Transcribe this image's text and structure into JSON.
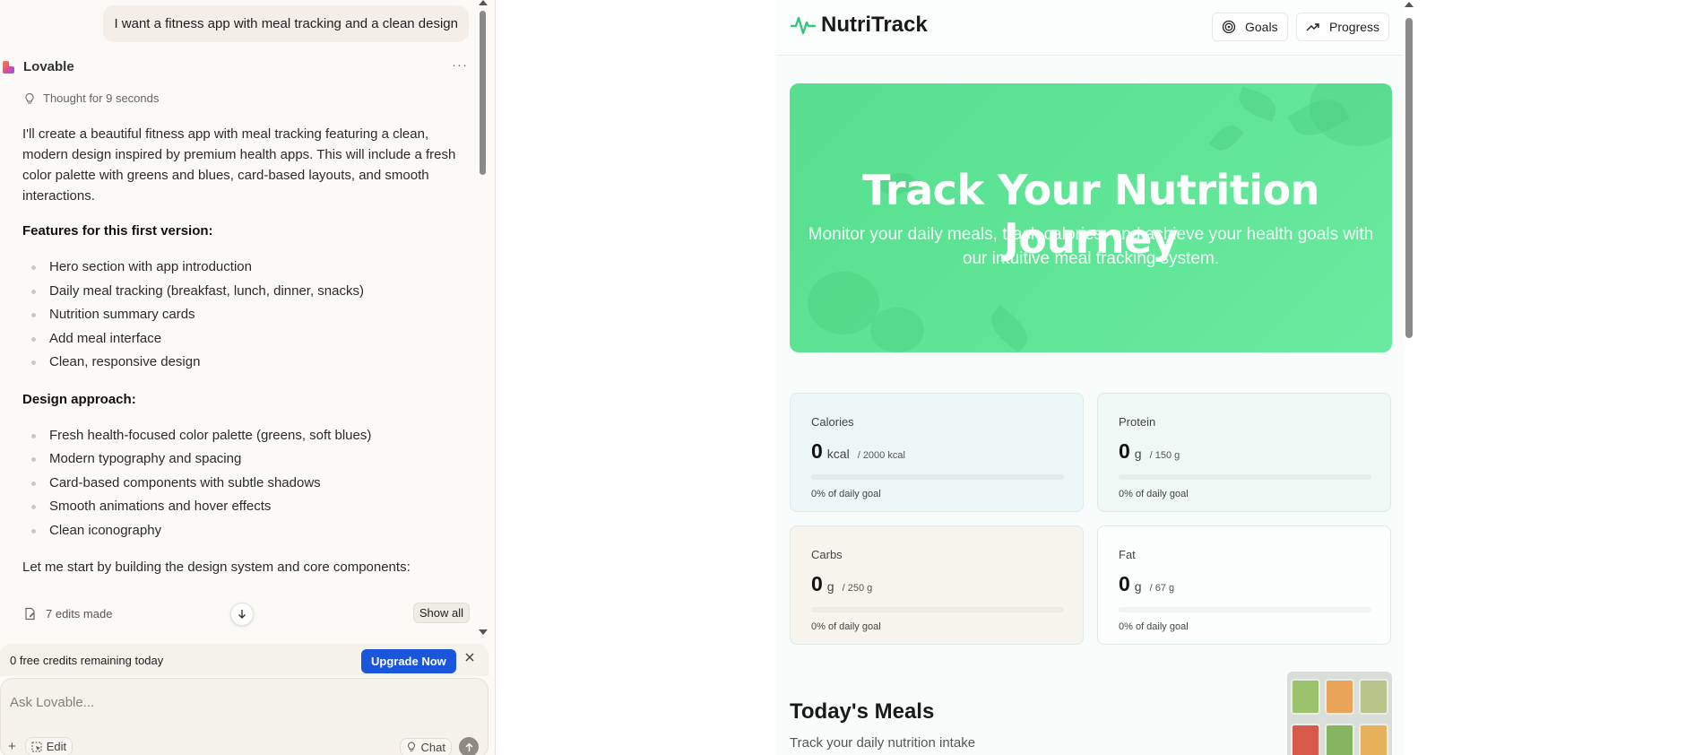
{
  "chat": {
    "user_message": "I want a fitness app with meal tracking and a clean design",
    "assistant_name": "Lovable",
    "more_label": "···",
    "thought": "Thought for 9 seconds",
    "intro": "I'll create a beautiful fitness app with meal tracking featuring a clean, modern design inspired by premium health apps. This will include a fresh color palette with greens and blues, card-based layouts, and smooth interactions.",
    "features_heading": "Features for this first version:",
    "features": [
      "Hero section with app introduction",
      "Daily meal tracking (breakfast, lunch, dinner, snacks)",
      "Nutrition summary cards",
      "Add meal interface",
      "Clean, responsive design"
    ],
    "design_heading": "Design approach:",
    "design_items": [
      "Fresh health-focused color palette (greens, soft blues)",
      "Modern typography and spacing",
      "Card-based components with subtle shadows",
      "Smooth animations and hover effects",
      "Clean iconography"
    ],
    "closing": "Let me start by building the design system and core components:",
    "edits_made": "7 edits made",
    "show_all": "Show all",
    "credits_text": "0 free credits remaining today",
    "upgrade_label": "Upgrade Now",
    "input_placeholder": "Ask Lovable...",
    "add_label": "+",
    "edit_label": "Edit",
    "chat_label": "Chat"
  },
  "preview": {
    "brand": "NutriTrack",
    "nav": [
      {
        "label": "Goals",
        "icon": "target-icon"
      },
      {
        "label": "Progress",
        "icon": "trending-up-icon"
      }
    ],
    "hero_title": "Track Your Nutrition Journey",
    "hero_subtitle": "Monitor your daily meals, track calories, and achieve your health goals with our intuitive meal tracking system.",
    "cards": [
      {
        "label": "Calories",
        "value": "0",
        "unit": "kcal",
        "goal": "/ 2000 kcal",
        "pct": "0% of daily goal",
        "progress": 0
      },
      {
        "label": "Protein",
        "value": "0",
        "unit": "g",
        "goal": "/ 150 g",
        "pct": "0% of daily goal",
        "progress": 0
      },
      {
        "label": "Carbs",
        "value": "0",
        "unit": "g",
        "goal": "/ 250 g",
        "pct": "0% of daily goal",
        "progress": 0
      },
      {
        "label": "Fat",
        "value": "0",
        "unit": "g",
        "goal": "/ 67 g",
        "pct": "0% of daily goal",
        "progress": 0
      }
    ],
    "meals_title": "Today's Meals",
    "meals_subtitle": "Track your daily nutrition intake"
  },
  "colors": {
    "accent_green": "#3fcf7e",
    "hero_green": "#5ee495",
    "upgrade_blue": "#1a56db"
  }
}
